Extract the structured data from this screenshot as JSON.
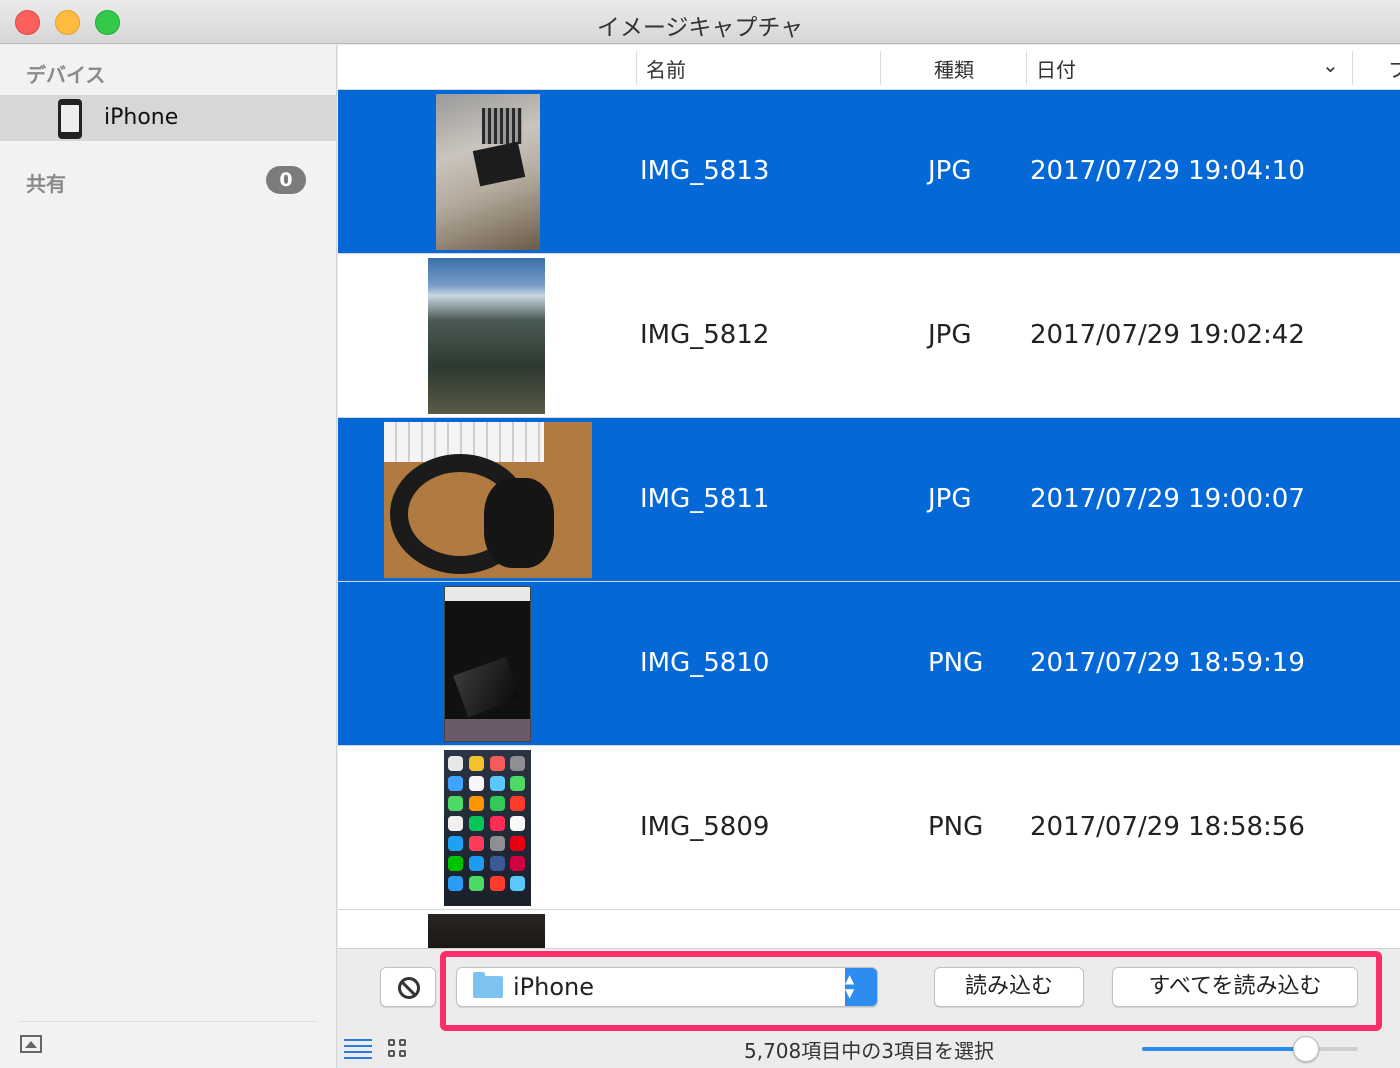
{
  "window": {
    "title": "イメージキャプチャ"
  },
  "sidebar": {
    "devices_heading": "デバイス",
    "device_name": "iPhone",
    "shared_heading": "共有",
    "shared_count": "0"
  },
  "columns": {
    "name": "名前",
    "type": "種類",
    "date": "日付",
    "more": "フ"
  },
  "rows": [
    {
      "name": "IMG_5813",
      "type": "JPG",
      "date": "2017/07/29 19:04:10",
      "selected": true
    },
    {
      "name": "IMG_5812",
      "type": "JPG",
      "date": "2017/07/29 19:02:42",
      "selected": false
    },
    {
      "name": "IMG_5811",
      "type": "JPG",
      "date": "2017/07/29 19:00:07",
      "selected": true
    },
    {
      "name": "IMG_5810",
      "type": "PNG",
      "date": "2017/07/29 18:59:19",
      "selected": true
    },
    {
      "name": "IMG_5809",
      "type": "PNG",
      "date": "2017/07/29 18:58:56",
      "selected": false
    }
  ],
  "toolbar": {
    "destination": "iPhone",
    "import_label": "読み込む",
    "import_all_label": "すべてを読み込む",
    "status": "5,708項目中の3項目を選択",
    "thumbnail_size": 0.76
  },
  "colors": {
    "selection": "#0469d7",
    "highlight": "#fb2e6c",
    "accent": "#2d8cf0"
  },
  "icons": [
    "phone-icon",
    "folder-icon",
    "stop-icon",
    "list-view-icon",
    "grid-view-icon",
    "sidebar-toggle-icon",
    "chevron-down-icon"
  ]
}
